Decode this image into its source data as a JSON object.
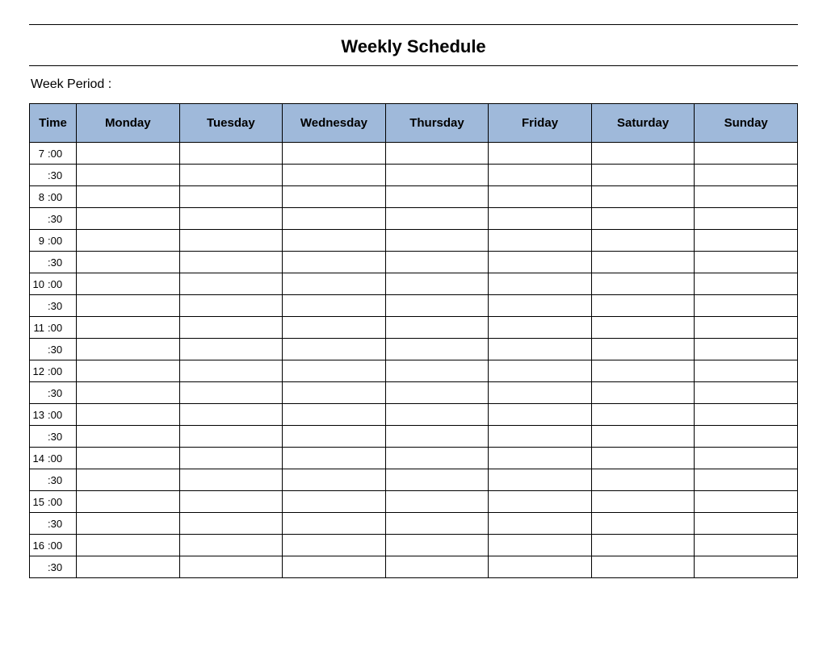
{
  "title": "Weekly Schedule",
  "week_period_label": "Week  Period :",
  "headers": {
    "time": "Time",
    "days": [
      "Monday",
      "Tuesday",
      "Wednesday",
      "Thursday",
      "Friday",
      "Saturday",
      "Sunday"
    ]
  },
  "rows": [
    {
      "hour": "7",
      "mins": ":00",
      "half": false
    },
    {
      "hour": "",
      "mins": ":30",
      "half": true
    },
    {
      "hour": "8",
      "mins": ":00",
      "half": false
    },
    {
      "hour": "",
      "mins": ":30",
      "half": true
    },
    {
      "hour": "9",
      "mins": ":00",
      "half": false
    },
    {
      "hour": "",
      "mins": ":30",
      "half": true
    },
    {
      "hour": "10",
      "mins": ":00",
      "half": false
    },
    {
      "hour": "",
      "mins": ":30",
      "half": true
    },
    {
      "hour": "11",
      "mins": ":00",
      "half": false
    },
    {
      "hour": "",
      "mins": ":30",
      "half": true
    },
    {
      "hour": "12",
      "mins": ":00",
      "half": false
    },
    {
      "hour": "",
      "mins": ":30",
      "half": true
    },
    {
      "hour": "13",
      "mins": ":00",
      "half": false
    },
    {
      "hour": "",
      "mins": ":30",
      "half": true
    },
    {
      "hour": "14",
      "mins": ":00",
      "half": false
    },
    {
      "hour": "",
      "mins": ":30",
      "half": true
    },
    {
      "hour": "15",
      "mins": ":00",
      "half": false
    },
    {
      "hour": "",
      "mins": ":30",
      "half": true
    },
    {
      "hour": "16",
      "mins": ":00",
      "half": false
    },
    {
      "hour": "",
      "mins": ":30",
      "half": true
    }
  ]
}
